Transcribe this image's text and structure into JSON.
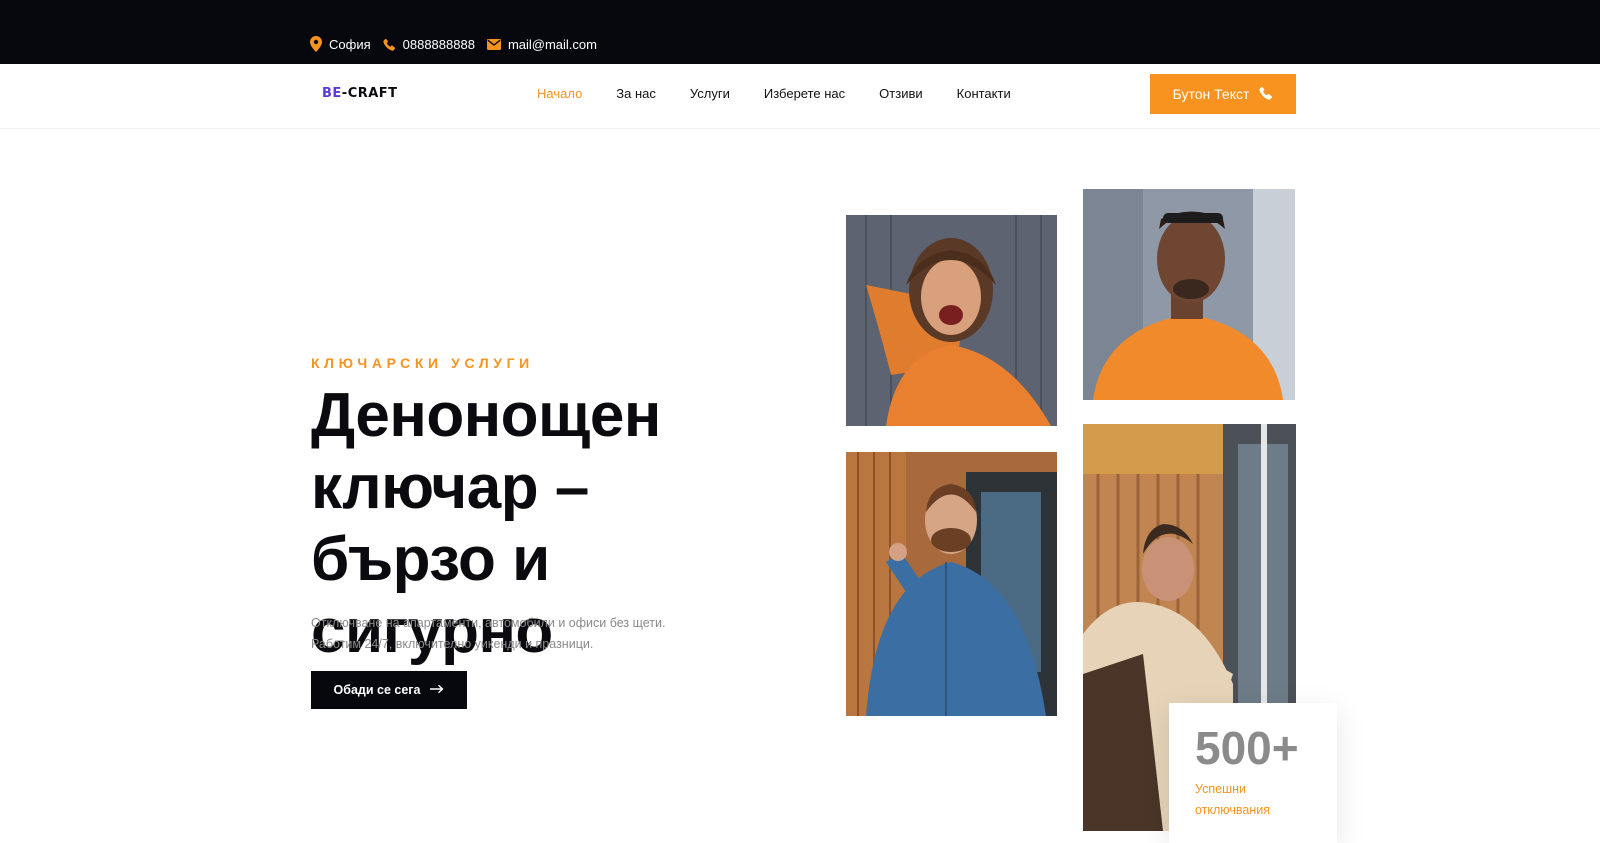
{
  "topbar": {
    "city": "София",
    "phone": "0888888888",
    "email": "mail@mail.com"
  },
  "header": {
    "logo_text_prefix": "BE",
    "logo_text_rest": "-CRAFT",
    "nav": [
      {
        "label": "Начало",
        "active": true
      },
      {
        "label": "За нас",
        "active": false
      },
      {
        "label": "Услуги",
        "active": false
      },
      {
        "label": "Изберете нас",
        "active": false
      },
      {
        "label": "Отзиви",
        "active": false
      },
      {
        "label": "Контакти",
        "active": false
      }
    ],
    "cta_label": "Бутон Текст"
  },
  "hero": {
    "eyebrow": "КЛЮЧАРСКИ УСЛУГИ",
    "headline": "Денонощен ключар – бързо и сигурно",
    "description_line1": "Отключване на апартаменти, автомобили и офиси без щети.",
    "description_line2": "Работим 24/7, включително уикенди и празници.",
    "button_label": "Обади се сега"
  },
  "stat": {
    "value": "500+",
    "label": "Успешни отключвания"
  },
  "colors": {
    "accent": "#f7931e",
    "dark": "#07080d",
    "muted": "#8a8a8a"
  },
  "icons": [
    "map-pin-icon",
    "phone-icon",
    "mail-icon",
    "phone-icon",
    "arrow-right-icon"
  ]
}
